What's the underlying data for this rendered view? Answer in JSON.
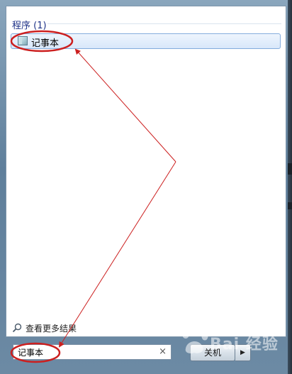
{
  "start_menu": {
    "group_heading": "程序 (1)",
    "program_item": "记事本",
    "see_more": "查看更多结果",
    "search_value": "记事本",
    "clear_symbol": "×",
    "shutdown_label": "关机",
    "shutdown_arrow": "▶"
  },
  "watermark": {
    "text": "Bai 经验"
  },
  "colors": {
    "annotation": "#cc1f1f",
    "heading": "#1e3287"
  }
}
